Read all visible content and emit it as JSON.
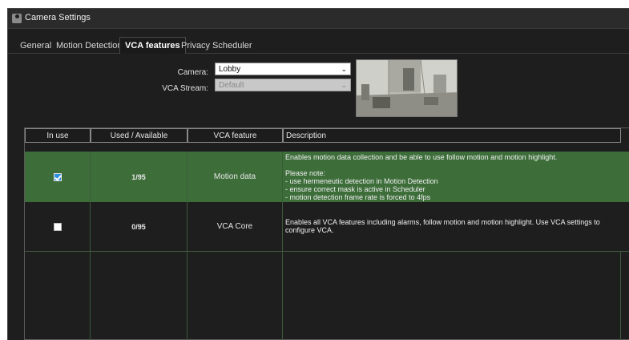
{
  "window": {
    "title": "Camera Settings"
  },
  "tabs": [
    {
      "label": "General"
    },
    {
      "label": "Motion Detection"
    },
    {
      "label": "VCA features"
    },
    {
      "label": "Privacy"
    },
    {
      "label": "Scheduler"
    }
  ],
  "camera_field": {
    "label": "Camera:",
    "value": "Lobby"
  },
  "stream_field": {
    "label": "VCA Stream:",
    "value": "Default"
  },
  "table": {
    "headers": [
      "In use",
      "Used  / Available",
      "VCA feature",
      "Description"
    ],
    "rows": [
      {
        "in_use": true,
        "used_available": "1/95",
        "feature": "Motion data",
        "description": "Enables motion data collection and be able to use follow motion and motion highlight.\n\nPlease note:\n- use hermeneutic detection in Motion Detection\n- ensure correct mask is active in Scheduler\n- motion detection frame rate is forced to 4fps"
      },
      {
        "in_use": false,
        "used_available": "0/95",
        "feature": "VCA Core",
        "description": "Enables all VCA features including alarms, follow motion and motion highlight. Use VCA settings to\nconfigure VCA."
      }
    ]
  },
  "colors": {
    "selected_row": "#3d6e3a",
    "checkbox_on": "#2f8fe0",
    "background": "#1e1e1e"
  }
}
